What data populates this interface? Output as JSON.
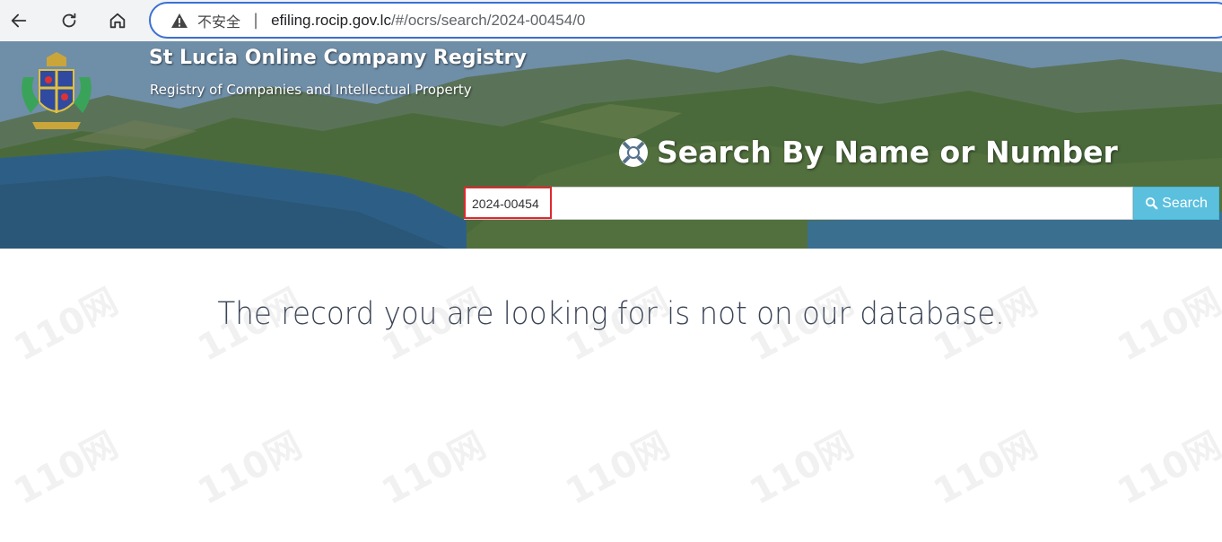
{
  "browser": {
    "insecure_label": "不安全",
    "separator": "|",
    "url_host": "efiling.rocip.gov.lc",
    "url_path": "/#/ocrs/search/2024-00454/0"
  },
  "header": {
    "title": "St Lucia Online Company Registry",
    "subtitle": "Registry of Companies and Intellectual Property"
  },
  "search": {
    "heading": "Search By Name or Number",
    "input_value": "2024-00454",
    "button_label": "Search"
  },
  "main": {
    "message": "The record you are looking for is not on our database."
  },
  "watermark": {
    "text": "110网"
  },
  "colors": {
    "accent": "#5bc0de",
    "highlight_border": "#e0282e",
    "address_border": "#3b6fd4",
    "message_text": "#3a4456"
  }
}
